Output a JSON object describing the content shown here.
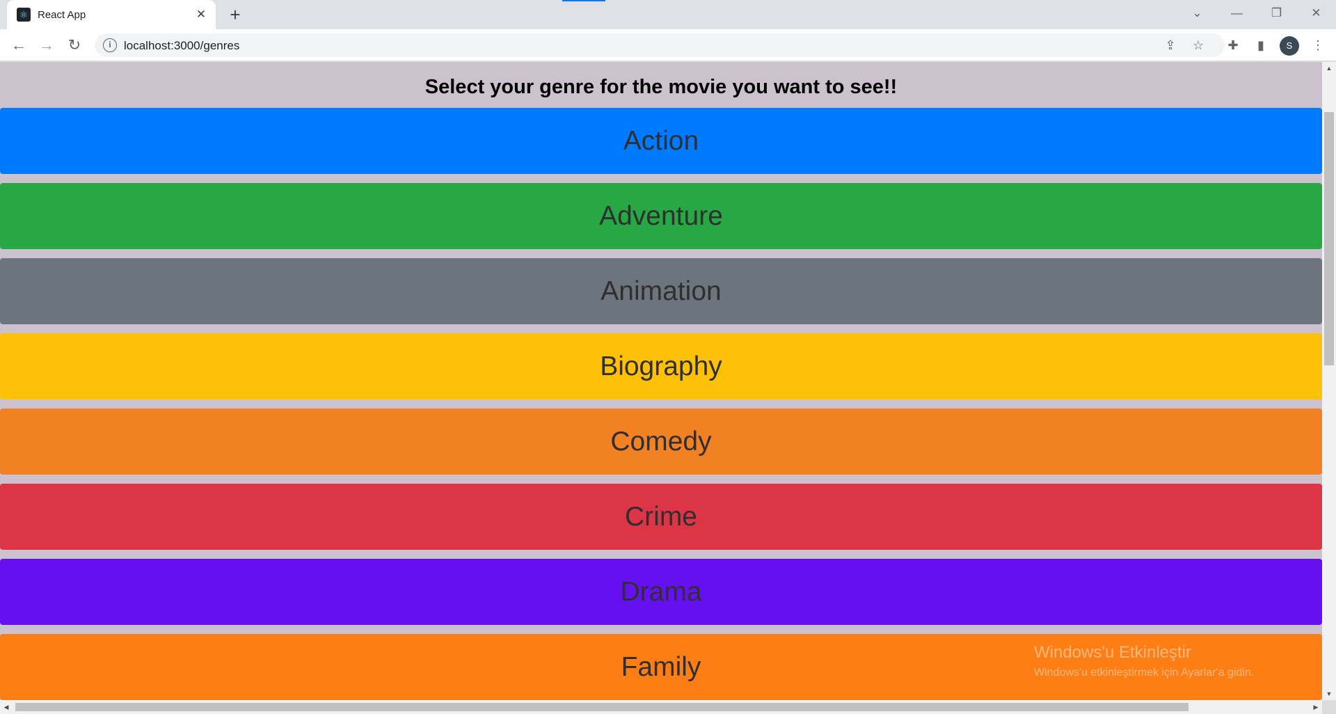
{
  "browser": {
    "tab": {
      "title": "React App",
      "favicon": "react-logo-icon",
      "close": "✕"
    },
    "new_tab": "+",
    "window_controls": {
      "dropdown": "⌄",
      "minimize": "—",
      "restore": "❐",
      "close": "✕"
    },
    "nav": {
      "back": "←",
      "forward": "→",
      "reload": "↻"
    },
    "address": {
      "info_icon": "i",
      "url": "localhost:3000/genres"
    },
    "actions": {
      "share": "⇪",
      "bookmark": "☆",
      "extensions": "✚",
      "side_panel": "▮",
      "menu": "⋮"
    },
    "profile_initial": "S"
  },
  "page": {
    "title": "Select your genre for the movie you want to see!!",
    "genres": [
      {
        "label": "Action",
        "color": "#007bff"
      },
      {
        "label": "Adventure",
        "color": "#28a745"
      },
      {
        "label": "Animation",
        "color": "#6c757d"
      },
      {
        "label": "Biography",
        "color": "#ffc107"
      },
      {
        "label": "Comedy",
        "color": "#f28123"
      },
      {
        "label": "Crime",
        "color": "#dc3545"
      },
      {
        "label": "Drama",
        "color": "#6610f2"
      },
      {
        "label": "Family",
        "color": "#fd7e14"
      }
    ]
  },
  "watermark": {
    "line1": "Windows'u Etkinleştir",
    "line2": "Windows'u etkinleştirmek için Ayarlar'a gidin."
  },
  "scrollbars": {
    "up": "▲",
    "down": "▼",
    "left": "◀",
    "right": "▶"
  }
}
